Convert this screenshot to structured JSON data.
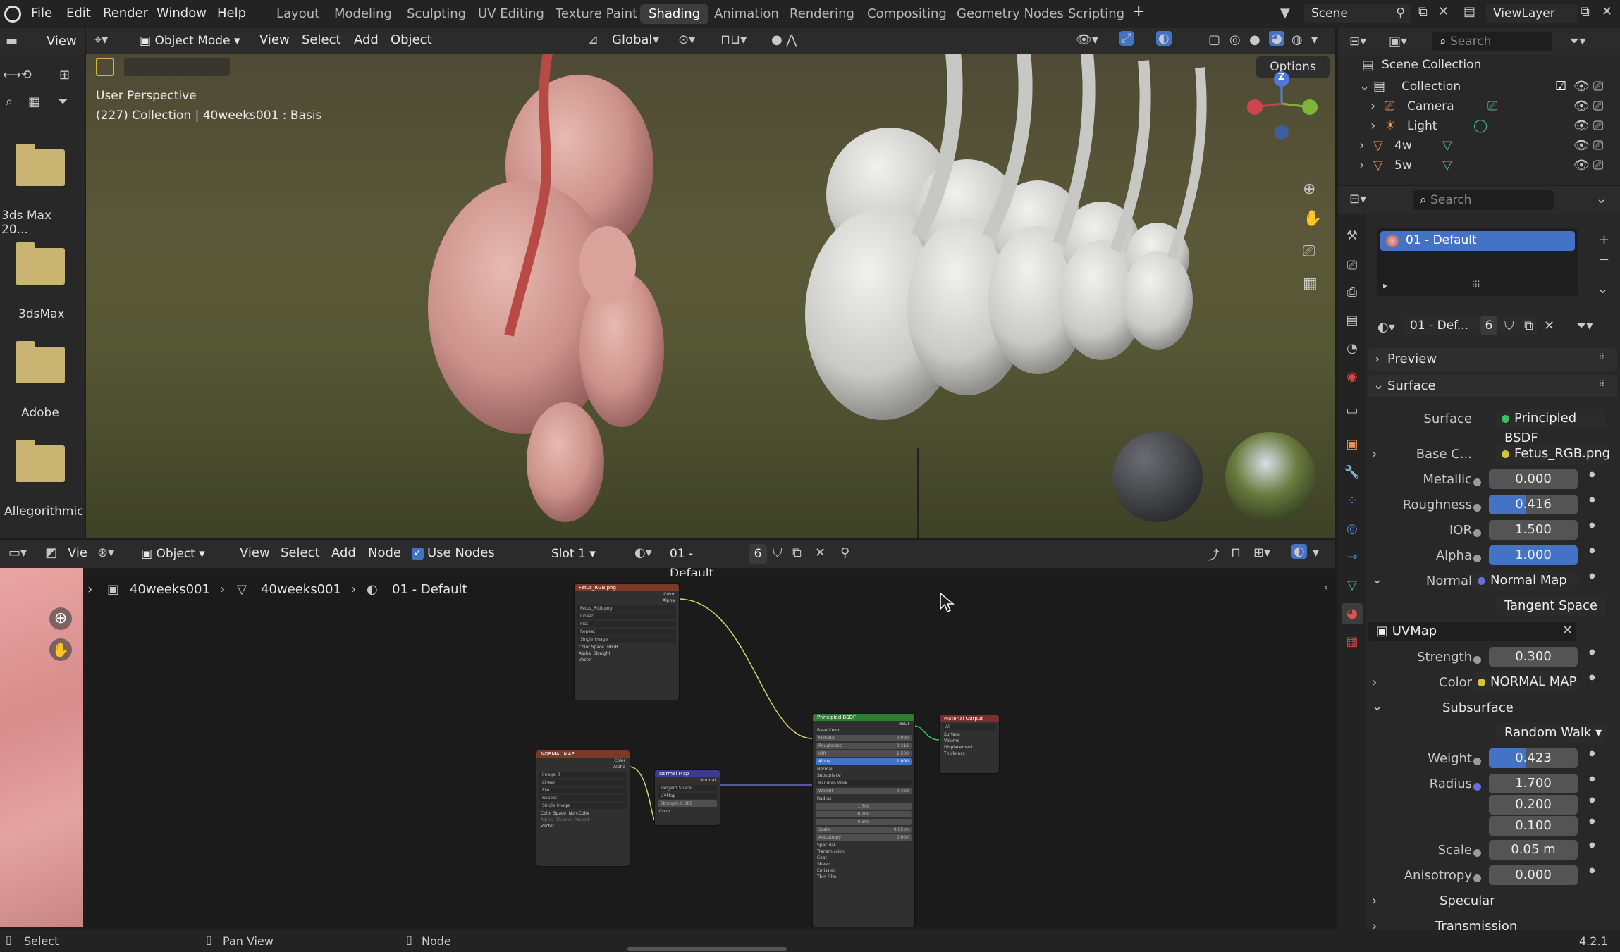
{
  "topbar": {
    "menus": [
      "File",
      "Edit",
      "Render",
      "Window",
      "Help"
    ],
    "workspaces": [
      "Layout",
      "Modeling",
      "Sculpting",
      "UV Editing",
      "Texture Paint",
      "Shading",
      "Animation",
      "Rendering",
      "Compositing",
      "Geometry Nodes",
      "Scripting"
    ],
    "active_workspace": "Shading",
    "scene": "Scene",
    "view_layer": "ViewLayer"
  },
  "left_browser": {
    "view_label": "View",
    "folders": [
      "3ds Max 20...",
      "3dsMax",
      "Adobe",
      "Allegorithmic"
    ]
  },
  "viewport": {
    "mode": "Object Mode",
    "menus": [
      "View",
      "Select",
      "Add",
      "Object"
    ],
    "transform_orientation": "Global",
    "options_label": "Options",
    "overlay_line1": "User Perspective",
    "overlay_line2": "(227) Collection | 40weeks001 : Basis",
    "gizmo_axis_z": "Z"
  },
  "outliner": {
    "search_placeholder": "Search",
    "scene_collection": "Scene Collection",
    "items": [
      {
        "name": "Collection"
      },
      {
        "name": "Camera"
      },
      {
        "name": "Light"
      },
      {
        "name": "4w"
      },
      {
        "name": "5w"
      }
    ]
  },
  "node_editor": {
    "object_label": "Object",
    "menus": [
      "View",
      "Select",
      "Add",
      "Node"
    ],
    "use_nodes": "Use Nodes",
    "slot": "Slot 1",
    "material": "01 - Default",
    "user_count": "6",
    "breadcrumb": [
      "40weeks001",
      "40weeks001",
      "01 - Default"
    ],
    "left_view_label": "Vie",
    "nodes": {
      "image_tex": {
        "title": "Fetus_RGB.png",
        "outputs": [
          "Color",
          "Alpha"
        ],
        "image": "Fetus_RGB.png",
        "rows": [
          "Linear",
          "Flat",
          "Repeat",
          "Single Image"
        ],
        "color_space_label": "Color Space",
        "color_space": "sRGB",
        "alpha_label": "Alpha",
        "alpha": "Straight",
        "vector": "Vector"
      },
      "normal_tex": {
        "title": "NORMAL MAP",
        "outputs": [
          "Color",
          "Alpha"
        ],
        "image": "Image_0",
        "rows": [
          "Linear",
          "Flat",
          "Repeat",
          "Single Image"
        ],
        "color_space_label": "Color Space",
        "color_space": "Non-Color",
        "alpha_label": "Alpha",
        "alpha": "Channel Packed",
        "vector": "Vector"
      },
      "normal_map": {
        "title": "Normal Map",
        "output": "Normal",
        "space": "Tangent Space",
        "uv": "UVMap",
        "strength_label": "Strength",
        "strength": "0.300",
        "color": "Color"
      },
      "bsdf": {
        "title": "Principled BSDF",
        "output": "BSDF",
        "base_color": "Base Color",
        "rows": [
          [
            "Metallic",
            "0.000"
          ],
          [
            "Roughness",
            "0.416"
          ],
          [
            "IOR",
            "1.500"
          ],
          [
            "Alpha",
            "1.000"
          ]
        ],
        "normal": "Normal",
        "subsurface": "Subsurface",
        "method": "Random Walk",
        "weight_label": "Weight",
        "weight": "0.423",
        "radius_label": "Radius",
        "radius": [
          "1.700",
          "0.200",
          "0.100"
        ],
        "scale_label": "Scale",
        "scale": "0.05 m",
        "aniso_label": "Anisotropy",
        "aniso": "0.000",
        "sections": [
          "Specular",
          "Transmission",
          "Coat",
          "Sheen",
          "Emission",
          "Thin Film"
        ]
      },
      "output": {
        "title": "Material Output",
        "target": "All",
        "inputs": [
          "Surface",
          "Volume",
          "Displacement",
          "Thickness"
        ]
      }
    }
  },
  "properties": {
    "search_placeholder": "Search",
    "slot_name": "01 - Default",
    "material_name": "01 - Def...",
    "user_count": "6",
    "preview": "Preview",
    "surface_section": "Surface",
    "surface_label": "Surface",
    "surface_value": "Principled BSDF",
    "base_color_label": "Base C...",
    "base_color_value": "Fetus_RGB.png",
    "metallic_label": "Metallic",
    "metallic": "0.000",
    "roughness_label": "Roughness",
    "roughness": "0.416",
    "ior_label": "IOR",
    "ior": "1.500",
    "alpha_label": "Alpha",
    "alpha": "1.000",
    "normal_label": "Normal",
    "normal_value": "Normal Map",
    "tangent_space": "Tangent Space",
    "uvmap": "UVMap",
    "strength_label": "Strength",
    "strength": "0.300",
    "color_label": "Color",
    "color_value": "NORMAL MAP",
    "subsurface": "Subsurface",
    "random_walk": "Random Walk",
    "weight_label": "Weight",
    "weight": "0.423",
    "radius_label": "Radius",
    "radius": [
      "1.700",
      "0.200",
      "0.100"
    ],
    "scale_label": "Scale",
    "scale": "0.05 m",
    "anisotropy_label": "Anisotropy",
    "anisotropy": "0.000",
    "specular": "Specular",
    "transmission": "Transmission",
    "roughness_fraction": 0.416,
    "weight_fraction": 0.423
  },
  "statusbar": {
    "select": "Select",
    "pan_view": "Pan View",
    "node": "Node",
    "version": "4.2.1"
  },
  "colors": {
    "accent": "#4472c4",
    "image_node": "#7a3a25",
    "normal_node": "#3b3b8f",
    "bsdf_node": "#2f7d32",
    "output_node": "#7a2e2e"
  }
}
